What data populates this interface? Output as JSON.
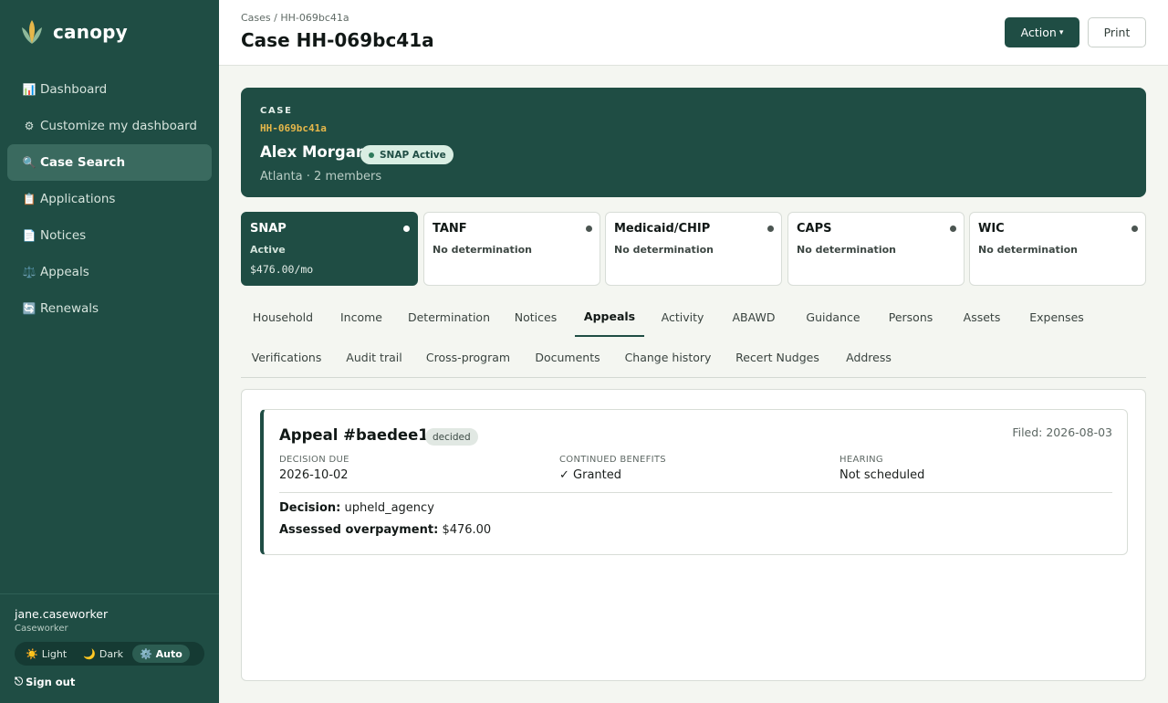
{
  "app": {
    "name": "canopy"
  },
  "sidebar": {
    "items": [
      {
        "icon": "📊",
        "icon_name": "chart-icon",
        "label": "Dashboard"
      },
      {
        "icon": "⚙",
        "icon_name": "gear-icon",
        "label": "Customize my dashboard"
      },
      {
        "icon": "🔍",
        "icon_name": "search-icon",
        "label": "Case Search",
        "active": true
      },
      {
        "icon": "📋",
        "icon_name": "clipboard-icon",
        "label": "Applications"
      },
      {
        "icon": "📄",
        "icon_name": "document-icon",
        "label": "Notices"
      },
      {
        "icon": "⚖️",
        "icon_name": "scales-icon",
        "label": "Appeals"
      },
      {
        "icon": "🔄",
        "icon_name": "refresh-icon",
        "label": "Renewals"
      }
    ],
    "user": {
      "name": "jane.caseworker",
      "role": "Caseworker"
    },
    "theme": {
      "light": {
        "icon": "☀️",
        "label": "Light"
      },
      "dark": {
        "icon": "🌙",
        "label": "Dark"
      },
      "auto": {
        "icon": "⚙️",
        "label": "Auto"
      },
      "selected": "Auto"
    },
    "signout": {
      "icon": "⎋",
      "label": "Sign out"
    }
  },
  "header": {
    "breadcrumb": "Cases / HH-069bc41a",
    "title": "Case HH-069bc41a",
    "action_label": "Action",
    "action_caret": "▾",
    "print_label": "Print"
  },
  "case": {
    "kicker": "CASE",
    "id": "HH-069bc41a",
    "name": "Alex Morgan",
    "status_pill": "SNAP Active",
    "subtitle": "Atlanta · 2 members"
  },
  "programs": [
    {
      "name": "SNAP",
      "status": "Active",
      "amount": "$476.00/mo",
      "active": true
    },
    {
      "name": "TANF",
      "status": "No determination"
    },
    {
      "name": "Medicaid/CHIP",
      "status": "No determination"
    },
    {
      "name": "CAPS",
      "status": "No determination"
    },
    {
      "name": "WIC",
      "status": "No determination"
    }
  ],
  "tabs": {
    "row1": [
      "Household",
      "Income",
      "Determination",
      "Notices",
      "Appeals",
      "Activity",
      "ABAWD",
      "Guidance",
      "Persons",
      "Assets",
      "Expenses"
    ],
    "row2": [
      "Verifications",
      "Audit trail",
      "Cross-program",
      "Documents",
      "Change history",
      "Recert Nudges",
      "Address"
    ],
    "selected": "Appeals"
  },
  "appeal": {
    "title": "Appeal #baedee11",
    "badge": "decided",
    "filed": "Filed: 2026-08-03",
    "decision_due": {
      "label": "DECISION DUE",
      "value": "2026-10-02"
    },
    "continued_benefits": {
      "label": "CONTINUED BENEFITS",
      "value": "✓ Granted"
    },
    "hearing": {
      "label": "HEARING",
      "value": "Not scheduled"
    },
    "decision": {
      "label": "Decision:",
      "value": "upheld_agency"
    },
    "overpayment": {
      "label": "Assessed overpayment:",
      "value": "$476.00"
    }
  },
  "colors": {
    "sidebar_bg": "#1f4d44",
    "accent": "#1f4d44",
    "case_id_gold": "#e6b74a",
    "page_bg": "#f4f6f1"
  }
}
